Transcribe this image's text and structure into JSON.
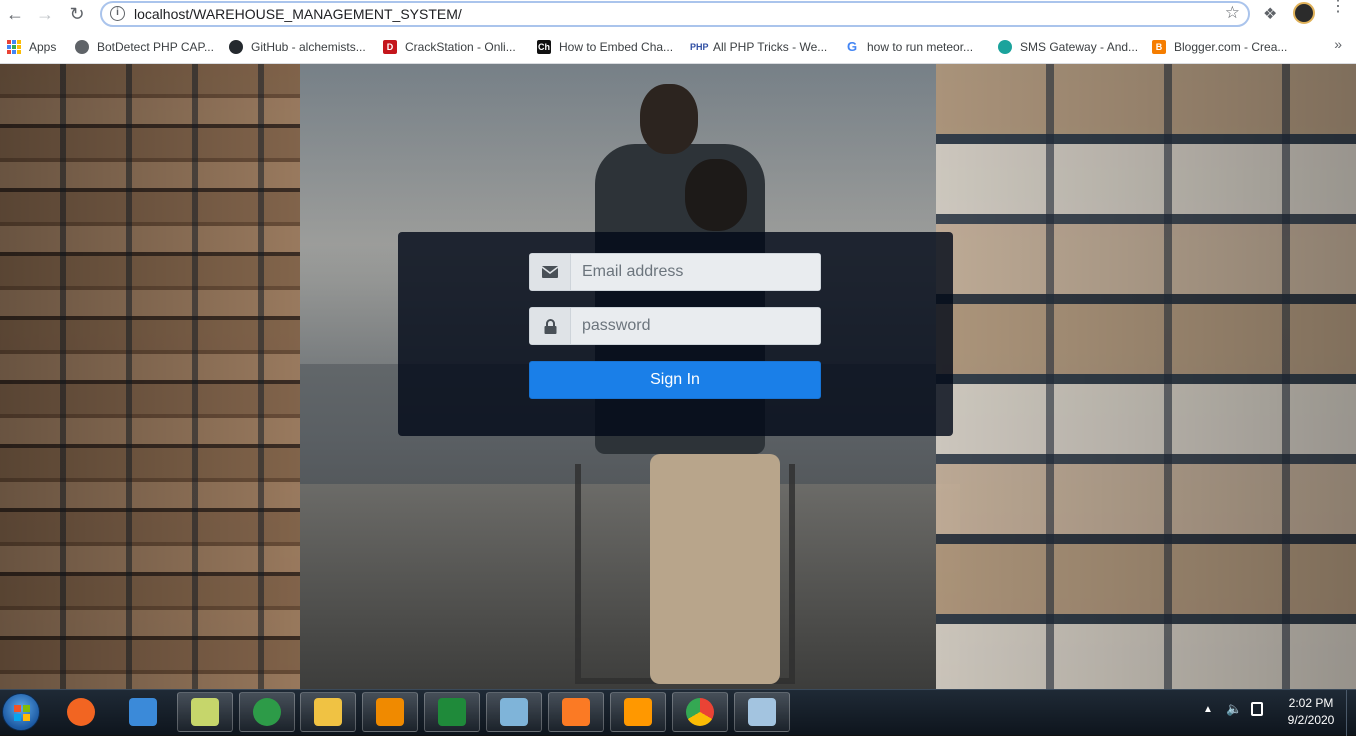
{
  "browser": {
    "url": "localhost/WAREHOUSE_MANAGEMENT_SYSTEM/",
    "bookmarks": [
      {
        "label": "Apps",
        "icon": "apps-grid-icon"
      },
      {
        "label": "BotDetect PHP CAP...",
        "icon": "globe-icon"
      },
      {
        "label": "GitHub - alchemists...",
        "icon": "github-icon"
      },
      {
        "label": "CrackStation - Onli...",
        "icon": "crackstation-icon"
      },
      {
        "label": "How to Embed Cha...",
        "icon": "ch-icon"
      },
      {
        "label": "All PHP Tricks - We...",
        "icon": "php-icon"
      },
      {
        "label": "how to run meteor...",
        "icon": "google-icon"
      },
      {
        "label": "SMS Gateway - And...",
        "icon": "sms-icon"
      },
      {
        "label": "Blogger.com - Crea...",
        "icon": "blogger-icon"
      }
    ],
    "bookmark_more": "»"
  },
  "login": {
    "email_placeholder": "Email address",
    "password_placeholder": "password",
    "signin_label": "Sign In"
  },
  "taskbar": {
    "apps": [
      {
        "name": "pen-app-icon",
        "color": "#f26522"
      },
      {
        "name": "git-app-icon",
        "color": "#3b8ad9"
      },
      {
        "name": "notes-app-icon",
        "color": "#c6d66b"
      },
      {
        "name": "mongodb-app-icon",
        "color": "#2d9b48"
      },
      {
        "name": "file-explorer-icon",
        "color": "#f0c243"
      },
      {
        "name": "vlc-icon",
        "color": "#f08a00"
      },
      {
        "name": "mongodb-compass-icon",
        "color": "#1f8a3a"
      },
      {
        "name": "book-app-icon",
        "color": "#7fb4d9"
      },
      {
        "name": "xampp-icon",
        "color": "#fb7a24"
      },
      {
        "name": "sublime-text-icon",
        "color": "#ff9800"
      },
      {
        "name": "chrome-icon",
        "color": "#4285f4"
      },
      {
        "name": "paint-icon",
        "color": "#a3c4e0"
      }
    ],
    "time": "2:02 PM",
    "date": "9/2/2020"
  }
}
